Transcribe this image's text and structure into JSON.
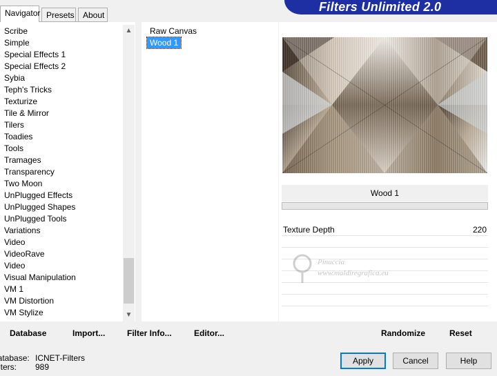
{
  "tabs": [
    "Navigator",
    "Presets",
    "About"
  ],
  "banner_title": "Filters Unlimited 2.0",
  "categories": [
    "Scribe",
    "Simple",
    "Special Effects 1",
    "Special Effects 2",
    "Sybia",
    "Teph's Tricks",
    "Texturize",
    "Tile & Mirror",
    "Tilers",
    "Toadies",
    "Tools",
    "Tramages",
    "Transparency",
    "Two Moon",
    "UnPlugged Effects",
    "UnPlugged Shapes",
    "UnPlugged Tools",
    "Variations",
    "Video",
    "VideoRave",
    "Video",
    "Visual Manipulation",
    "VM 1",
    "VM Distortion",
    "VM Stylize"
  ],
  "filters": [
    "Raw Canvas",
    "Wood 1"
  ],
  "selected_filter_index": 1,
  "filter_name": "Wood 1",
  "parameter": {
    "label": "Texture Depth",
    "value": "220"
  },
  "watermark": {
    "name": "Pinuccia",
    "url": "www.maldiregrafica.eu"
  },
  "left_buttons": [
    "Database",
    "Import...",
    "Filter Info...",
    "Editor..."
  ],
  "right_buttons": [
    "Randomize",
    "Reset"
  ],
  "status": {
    "database_label": "Database:",
    "database_value": "ICNET-Filters",
    "filters_label": "Filters:",
    "filters_value": "989"
  },
  "dialog_buttons": {
    "apply": "Apply",
    "cancel": "Cancel",
    "help": "Help"
  },
  "colors": {
    "banner": "#1d2fa3",
    "selection": "#3399ff",
    "default_button_border": "#0078d7"
  },
  "icons": {
    "scroll_up": "chevron-up-icon",
    "scroll_down": "chevron-down-icon"
  }
}
